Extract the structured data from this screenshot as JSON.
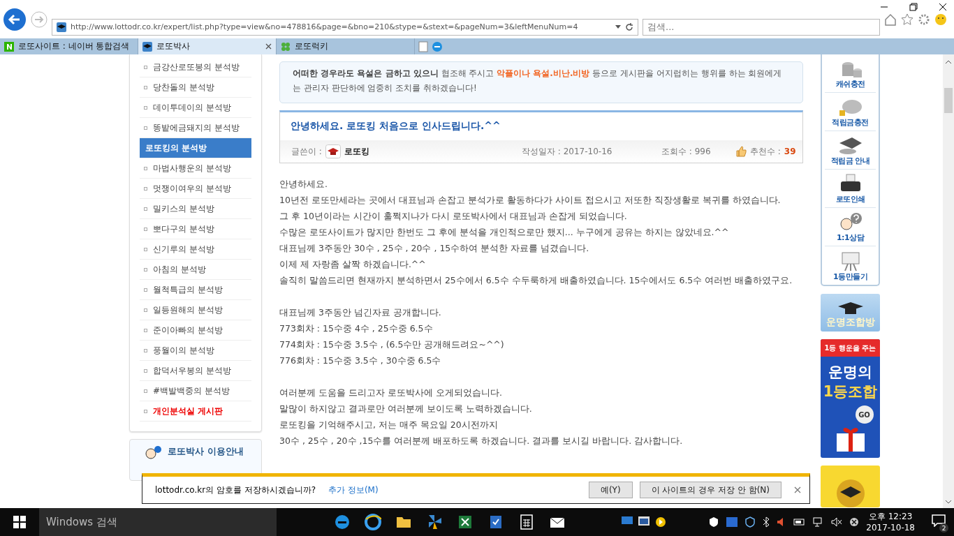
{
  "browser": {
    "url": "http://www.lottodr.co.kr/expert/list.php?type=view&no=478816&page=&bno=210&stype=&stext=&pageNum=3&leftMenuNum=4",
    "search": {
      "placeholder": "검색..."
    },
    "tabs": [
      {
        "label": "로또사이트 : 네이버 통합검색",
        "selected": false,
        "kind": "naver"
      },
      {
        "label": "로또박사",
        "selected": true,
        "kind": "site"
      },
      {
        "label": "로또럭키",
        "selected": false,
        "kind": "clover"
      }
    ]
  },
  "sidebar": {
    "items": [
      {
        "label": "금강산로또봉의 분석방",
        "selected": false,
        "kind": "normal"
      },
      {
        "label": "당찬돌의 분석방",
        "selected": false,
        "kind": "normal"
      },
      {
        "label": "데이투데이의 분석방",
        "selected": false,
        "kind": "normal"
      },
      {
        "label": "똥밭에금돼지의 분석방",
        "selected": false,
        "kind": "normal"
      },
      {
        "label": "로또킹의 분석방",
        "selected": true,
        "kind": "normal"
      },
      {
        "label": "마법사행운의 분석방",
        "selected": false,
        "kind": "normal"
      },
      {
        "label": "멋쟁이여우의 분석방",
        "selected": false,
        "kind": "normal"
      },
      {
        "label": "밀키스의 분석방",
        "selected": false,
        "kind": "normal"
      },
      {
        "label": "뽀다구의 분석방",
        "selected": false,
        "kind": "normal"
      },
      {
        "label": "신기루의 분석방",
        "selected": false,
        "kind": "normal"
      },
      {
        "label": "아침의 분석방",
        "selected": false,
        "kind": "normal"
      },
      {
        "label": "월척특급의 분석방",
        "selected": false,
        "kind": "normal"
      },
      {
        "label": "일등원해의 분석방",
        "selected": false,
        "kind": "normal"
      },
      {
        "label": "준이아빠의 분석방",
        "selected": false,
        "kind": "normal"
      },
      {
        "label": "풍월이의 분석방",
        "selected": false,
        "kind": "normal"
      },
      {
        "label": "합덕서우봉의 분석방",
        "selected": false,
        "kind": "normal"
      },
      {
        "label": "#백발백중의 분석방",
        "selected": false,
        "kind": "normal"
      },
      {
        "label": "개인분석실 게시판",
        "selected": false,
        "kind": "special"
      }
    ],
    "guide_title": "로또박사 이용안내"
  },
  "notice": [
    {
      "text": "어떠한 경우라도 욕설은 금하고 있으니",
      "kind": "bold"
    },
    {
      "text": " 협조해 주시고 ",
      "kind": "plain"
    },
    {
      "text": "악플이나 욕설.비난.비방",
      "kind": "warn"
    },
    {
      "text": " 등으로 게시판을 어지럽히는 행위를 하는 회원에게는 관리자 판단하에 엄중히 조치를 취하겠습니다!",
      "kind": "plain"
    }
  ],
  "post": {
    "title": "안녕하세요. 로또킹 처음으로 인사드립니다.^^",
    "author_label": "글쓴이 :",
    "author": "로또킹",
    "date": "작성일자 : 2017-10-16",
    "views": "조회수 : 996",
    "recommend_label": "추천수 :",
    "recommend": "39",
    "body": [
      [
        "안녕하세요.",
        "10년전 로또만세라는 곳에서 대표님과 손잡고 분석가로 활동하다가 사이트 접으시고 저또한 직장생활로 복귀를 하였습니다.",
        "그 후 10년이라는 시간이 훌쩍지나가 다시 로또박사에서 대표님과 손잡게 되었습니다.",
        "수많은 로또사이트가 많지만 한번도 그 후에 분석을 개인적으로만 했지... 누구에게 공유는 하지는 않았네요.^^",
        "대표님께 3주동안 30수 , 25수 , 20수 , 15수하여 분석한 자료를 넘겼습니다.",
        "이제 제 자랑좀 살짝 하겠습니다.^^",
        "솔직히 말씀드리면 현재까지 분석하면서 25수에서 6.5수 수두룩하게 배출하였습니다. 15수에서도 6.5수 여러번 배출하였구요."
      ],
      [
        "대표님께 3주동안 넘긴자료 공개합니다.",
        "773회차 : 15수중 4수 , 25수중 6.5수",
        "774회차 : 15수중 3.5수 , (6.5수만 공개해드려요~^^)",
        "776회차 : 15수중 3.5수 , 30수중 6.5수"
      ],
      [
        "여러분께 도움을 드리고자 로또박사에 오게되었습니다.",
        "말많이 하지않고 결과로만 여러분께 보이도록 노력하겠습니다.",
        "로또킹을 기억해주시고, 저는 매주 목요일 20시전까지",
        "30수 , 25수 , 20수 ,15수를 여러분께 배포하도록 하겠습니다. 결과를 보시길 바랍니다. 감사합니다."
      ]
    ]
  },
  "quick_menu": [
    {
      "label": "캐쉬충전",
      "kind": "coins"
    },
    {
      "label": "적립금충전",
      "kind": "piggy"
    },
    {
      "label": "적립금 안내",
      "kind": "cap"
    },
    {
      "label": "로또인쇄",
      "kind": "printer"
    },
    {
      "label": "1:1상담",
      "kind": "chat"
    },
    {
      "label": "1등만들기",
      "kind": "board"
    }
  ],
  "banners": {
    "room": "운명조합방",
    "promo_top": "1등 행운을 주는",
    "promo_title": [
      "운명의",
      "1등조합"
    ],
    "promo_go": "GO"
  },
  "password_bar": {
    "message": "lottodr.co.kr의 암호를 저장하시겠습니까?",
    "link": "추가 정보(M)",
    "buttons": [
      "예(Y)",
      "이 사이트의 경우 저장 안 함(N)"
    ]
  },
  "taskbar": {
    "search": "Windows 검색",
    "time": "오후 12:23",
    "date": "2017-10-18",
    "notifications": "2"
  }
}
